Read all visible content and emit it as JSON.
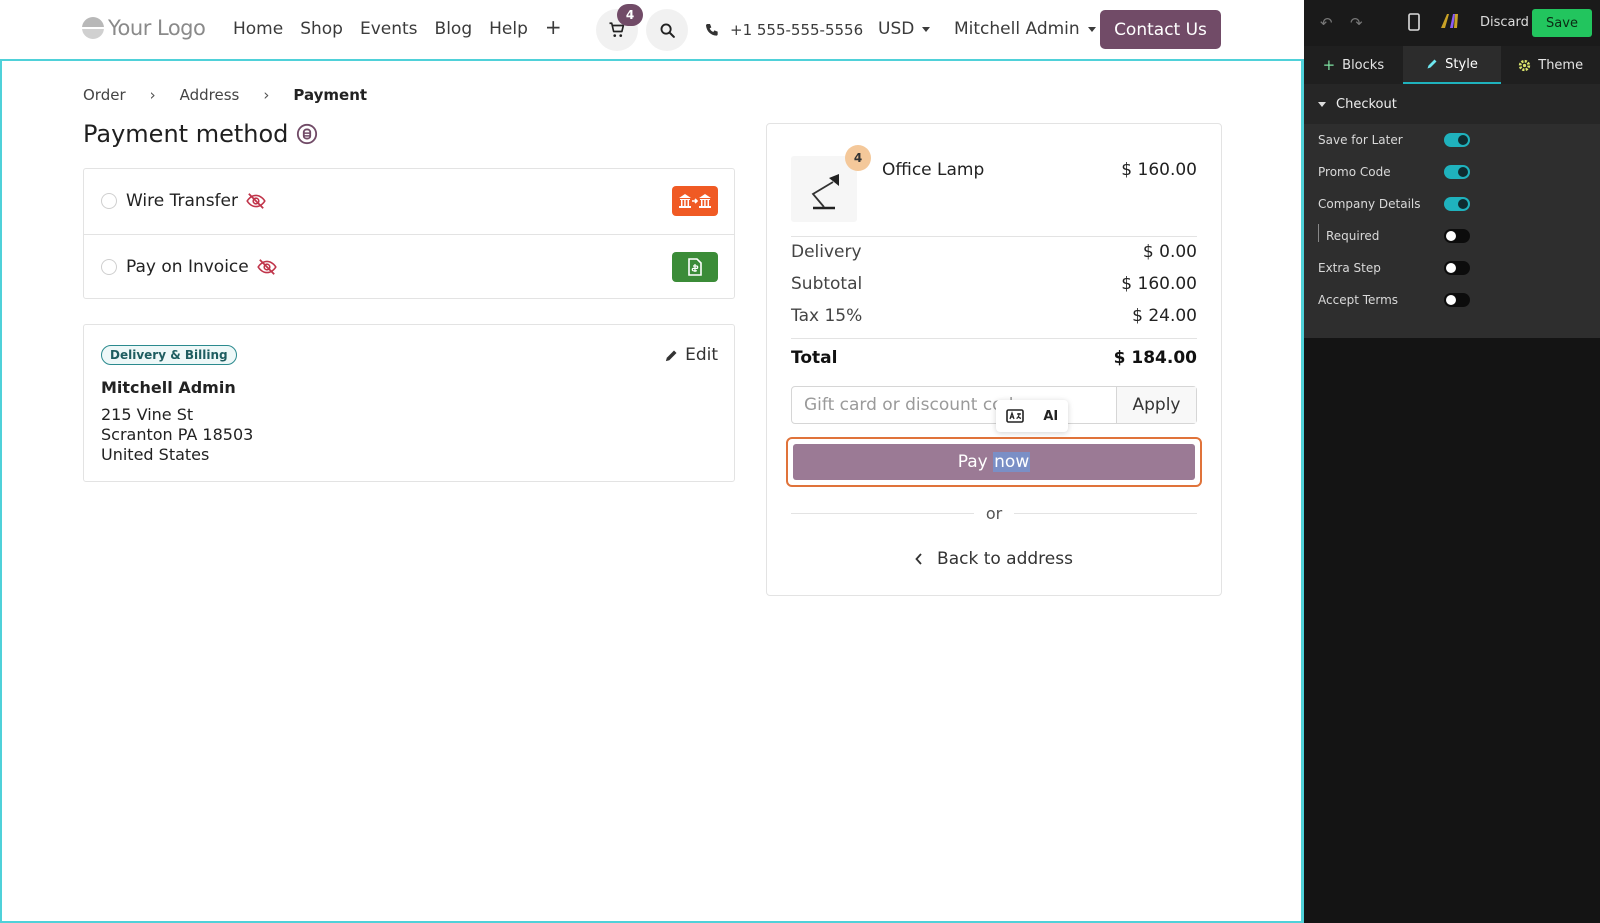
{
  "header": {
    "logo": "Your Logo",
    "nav": [
      "Home",
      "Shop",
      "Events",
      "Blog",
      "Help",
      "+"
    ],
    "cart_count": "4",
    "phone": "+1 555-555-5556",
    "currency": "USD",
    "user": "Mitchell Admin",
    "contact": "Contact Us"
  },
  "breadcrumb": {
    "order": "Order",
    "address": "Address",
    "payment": "Payment"
  },
  "title": "Payment method",
  "payment_methods": [
    {
      "label": "Wire Transfer",
      "icon_color": "#f05a24"
    },
    {
      "label": "Pay on Invoice",
      "icon_color": "#3b8c38"
    }
  ],
  "address": {
    "badge": "Delivery & Billing",
    "edit": "Edit",
    "name": "Mitchell Admin",
    "line1": "215 Vine St",
    "line2": "Scranton PA 18503",
    "line3": "United States"
  },
  "summary": {
    "product": {
      "name": "Office Lamp",
      "price": "$ 160.00",
      "qty": "4"
    },
    "delivery": {
      "label": "Delivery",
      "value": "$ 0.00"
    },
    "subtotal": {
      "label": "Subtotal",
      "value": "$ 160.00"
    },
    "tax": {
      "label": "Tax 15%",
      "value": "$ 24.00"
    },
    "total": {
      "label": "Total",
      "value": "$ 184.00"
    },
    "promo_placeholder": "Gift card or discount code",
    "apply": "Apply",
    "pay_now_a": "Pay",
    "pay_now_b": "now",
    "or": "or",
    "back": "Back to address",
    "ai_label": "AI"
  },
  "editor": {
    "discard": "Discard",
    "save": "Save",
    "tabs": [
      "Blocks",
      "Style",
      "Theme"
    ],
    "section": "Checkout",
    "options": [
      {
        "label": "Save for Later",
        "on": true
      },
      {
        "label": "Promo Code",
        "on": true
      },
      {
        "label": "Company Details",
        "on": true
      },
      {
        "label": "Required",
        "on": false
      },
      {
        "label": "Extra Step",
        "on": false
      },
      {
        "label": "Accept Terms",
        "on": false
      }
    ],
    "accent": "#1fb2bd"
  }
}
